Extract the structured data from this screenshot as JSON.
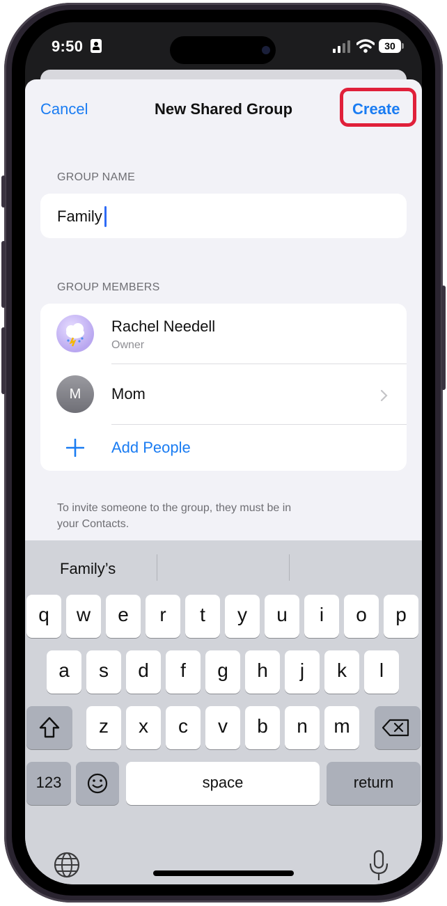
{
  "status": {
    "time": "9:50",
    "battery": "30"
  },
  "nav": {
    "cancel": "Cancel",
    "title": "New Shared Group",
    "create": "Create"
  },
  "group_name": {
    "label": "GROUP NAME",
    "value": "Family"
  },
  "members": {
    "label": "GROUP MEMBERS",
    "items": [
      {
        "name": "Rachel Needell",
        "role": "Owner"
      },
      {
        "name": "Mom",
        "initial": "M"
      }
    ],
    "add_label": "Add People",
    "footnote_line1": "To invite someone to the group, they must be in",
    "footnote_line2": "your Contacts."
  },
  "keyboard": {
    "suggestions": [
      "Family’s",
      "",
      ""
    ],
    "row1": [
      "q",
      "w",
      "e",
      "r",
      "t",
      "y",
      "u",
      "i",
      "o",
      "p"
    ],
    "row2": [
      "a",
      "s",
      "d",
      "f",
      "g",
      "h",
      "j",
      "k",
      "l"
    ],
    "row3": [
      "z",
      "x",
      "c",
      "v",
      "b",
      "n",
      "m"
    ],
    "numbers_key": "123",
    "space_key": "space",
    "return_key": "return"
  },
  "colors": {
    "accent": "#1a7cf2",
    "highlight": "#e0203a"
  },
  "icons": [
    "person-card-icon",
    "signal-icon",
    "wifi-icon",
    "battery-icon",
    "plus-icon",
    "chevron-right-icon",
    "shift-icon",
    "delete-icon",
    "emoji-icon",
    "globe-icon",
    "microphone-icon"
  ]
}
